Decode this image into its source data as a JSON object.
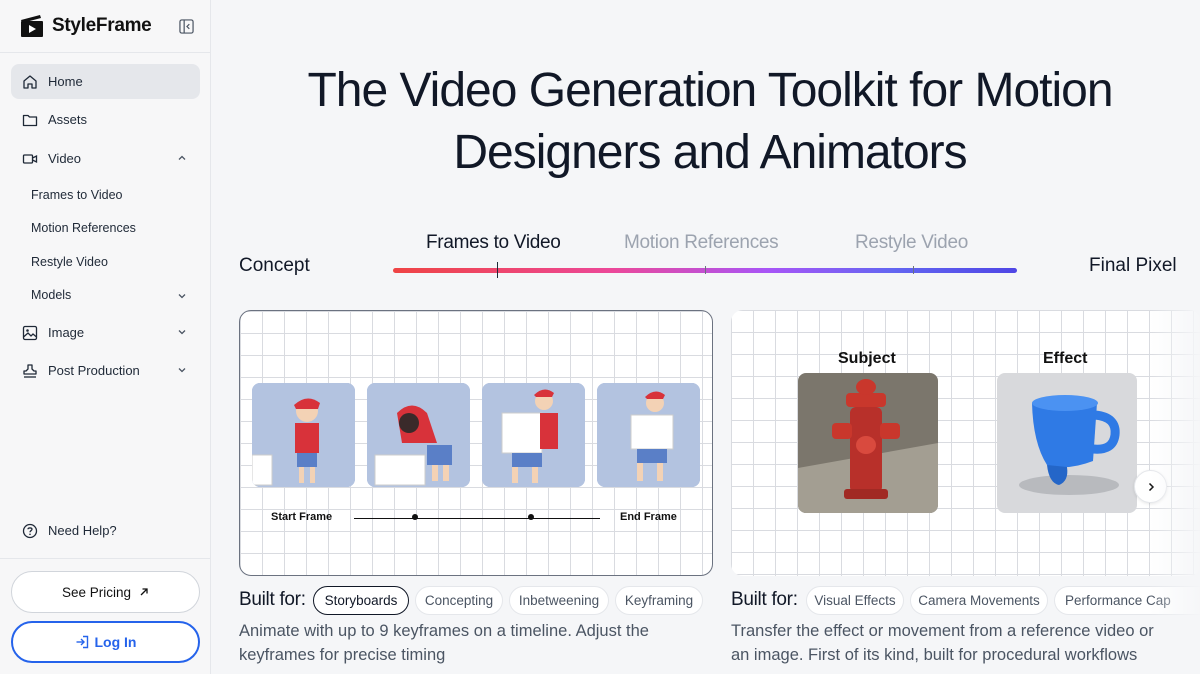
{
  "app": {
    "name": "StyleFrame"
  },
  "sidebar": {
    "items": [
      {
        "label": "Home",
        "icon": "home-icon"
      },
      {
        "label": "Assets",
        "icon": "folder-icon"
      },
      {
        "label": "Video",
        "icon": "video-icon"
      },
      {
        "label": "Image",
        "icon": "image-icon"
      },
      {
        "label": "Post Production",
        "icon": "stamp-icon"
      }
    ],
    "video_sub": [
      "Frames to Video",
      "Motion References",
      "Restyle Video",
      "Models"
    ],
    "help": "Need Help?",
    "pricing": "See Pricing",
    "login": "Log In"
  },
  "hero": {
    "title_line1": "The Video Generation Toolkit for Motion",
    "title_line2": "Designers and Animators"
  },
  "pipeline": {
    "start": "Concept",
    "end": "Final Pixel",
    "tabs": [
      "Frames to Video",
      "Motion References",
      "Restyle Video"
    ],
    "active_tab": "Frames to Video"
  },
  "card_frames": {
    "start_label": "Start Frame",
    "end_label": "End Frame",
    "built_for": "Built for:",
    "chips": [
      "Storyboards",
      "Concepting",
      "Inbetweening",
      "Keyframing"
    ],
    "selected_chip": "Storyboards",
    "description_line1": "Animate with up to 9 keyframes on a timeline. Adjust the",
    "description_line2": "keyframes for precise timing"
  },
  "card_motion": {
    "subject_label": "Subject",
    "effect_label": "Effect",
    "built_for": "Built for:",
    "chips": [
      "Visual Effects",
      "Camera Movements",
      "Performance Cap"
    ],
    "description_line1": "Transfer the effect or movement from a reference video or",
    "description_line2": "an image. First of its kind, built for procedural workflows"
  },
  "colors": {
    "accent": "#2563eb",
    "track_start": "#ef4444",
    "track_end": "#4f46e5"
  }
}
